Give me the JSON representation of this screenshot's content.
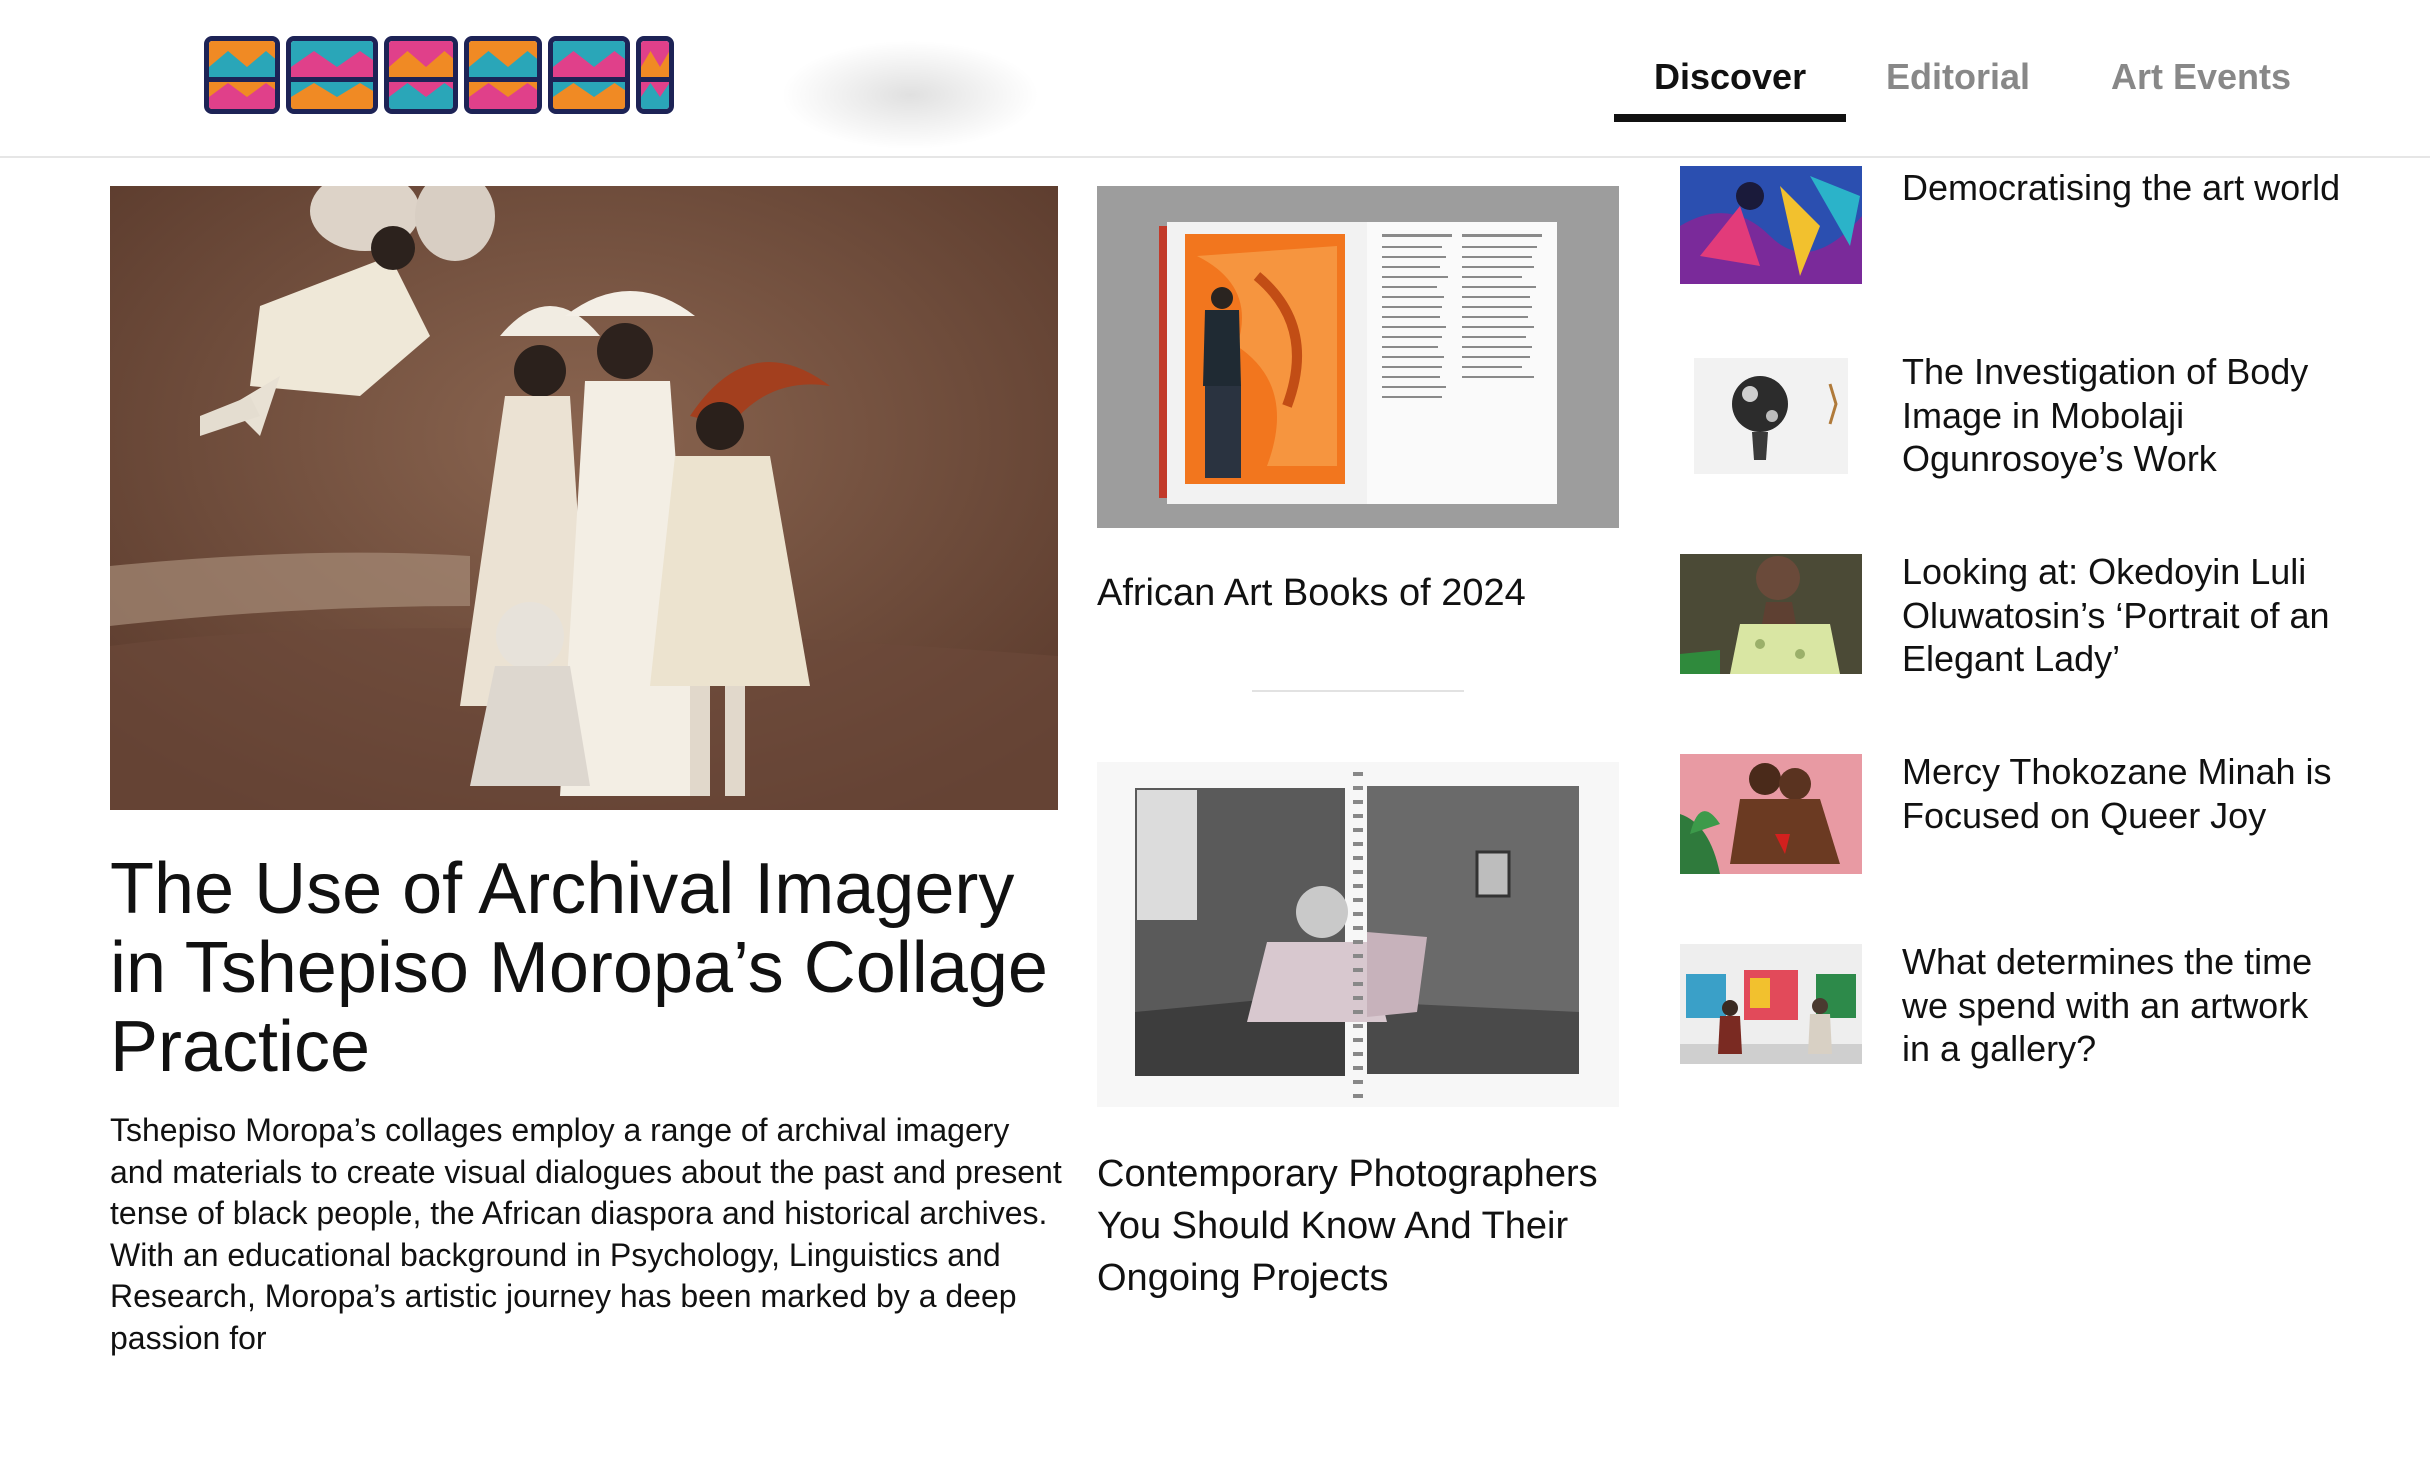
{
  "header": {
    "logo_text": "OMENAI",
    "nav": [
      {
        "label": "Discover",
        "active": true
      },
      {
        "label": "Editorial",
        "active": false
      },
      {
        "label": "Art Events",
        "active": false
      }
    ]
  },
  "hero": {
    "title": "The Use of Archival Imagery in Tshepiso Moropa’s Collage Practice",
    "description": "Tshepiso Moropa’s collages employ a range of archival imagery and materials to create visual dialogues about the past and present tense of black people, the African diaspora and historical archives. With an educational background in Psychology, Linguistics and Research, Moropa’s artistic journey has been marked by a deep passion for"
  },
  "middle": {
    "articles": [
      {
        "title": "African Art Books of 2024"
      },
      {
        "title": "Contemporary Photographers You Should Know And Their Ongoing Projects"
      }
    ]
  },
  "sidebar": {
    "articles": [
      {
        "title": "Democratising the art world"
      },
      {
        "title": "The Investigation of Body Image in Mobolaji Ogunrosoye’s Work"
      },
      {
        "title": "Looking at: Okedoyin Luli Oluwatosin’s ‘Portrait of an Elegant Lady’"
      },
      {
        "title": "Mercy Thokozane Minah is Focused on Queer Joy"
      },
      {
        "title": "What determines the time we spend with an artwork in a gallery?"
      }
    ]
  },
  "colors": {
    "logo_navy": "#1d2356",
    "logo_orange": "#f08a24",
    "logo_teal": "#2aa6b8",
    "logo_pink": "#e0408a",
    "nav_active": "#111111",
    "nav_inactive": "#888888"
  }
}
